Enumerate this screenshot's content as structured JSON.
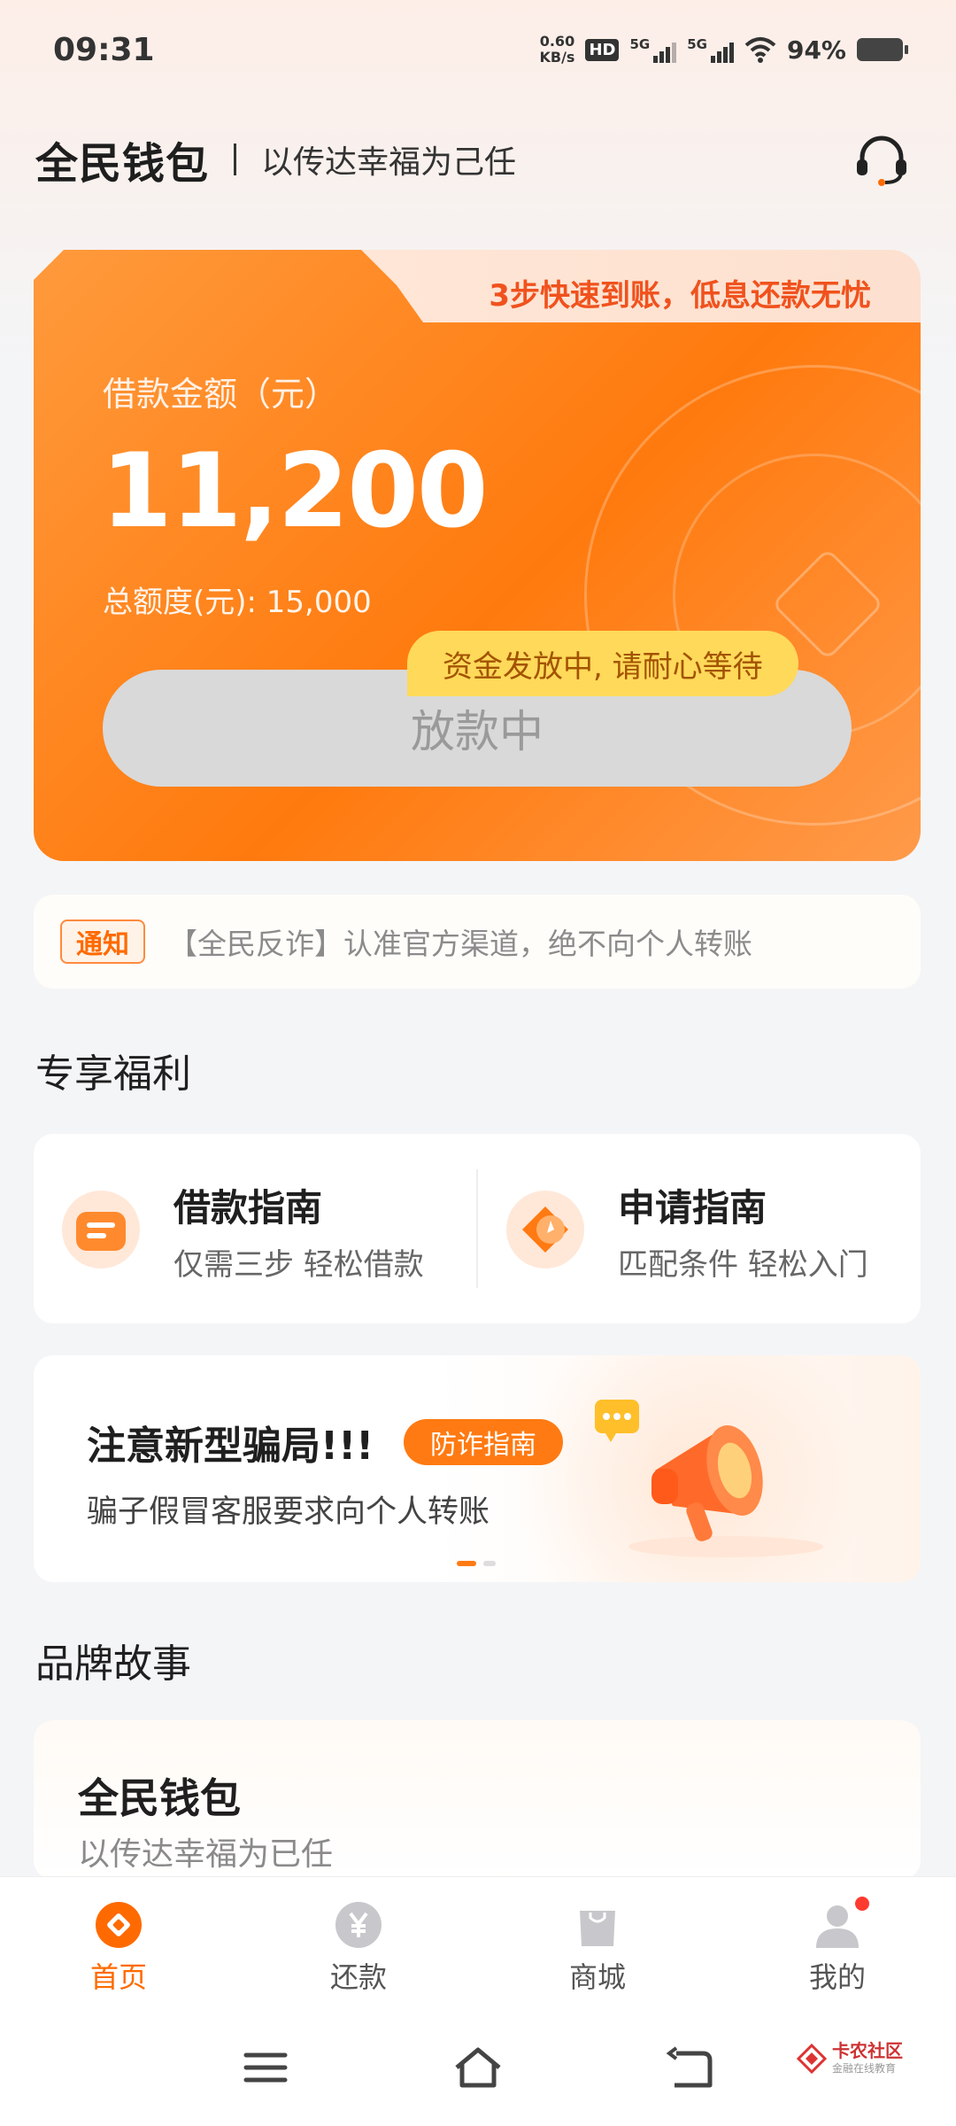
{
  "status_bar": {
    "time": "09:31",
    "net_speed_value": "0.60",
    "net_speed_unit": "KB/s",
    "hd_label": "HD",
    "sim1_label": "5G",
    "sim2_label": "5G",
    "battery": "94%"
  },
  "header": {
    "brand": "全民钱包",
    "slogan": "以传达幸福为己任"
  },
  "loan_card": {
    "tab_text": "3步快速到账，低息还款无忧",
    "amount_label": "借款金额（元）",
    "amount": "11,200",
    "total_limit": "总额度(元): 15,000",
    "status_button": "放款中",
    "tooltip": "资金发放中, 请耐心等待"
  },
  "notice": {
    "tag": "通知",
    "text": "【全民反诈】认准官方渠道，绝不向个人转账"
  },
  "benefits": {
    "title": "专享福利",
    "items": [
      {
        "title": "借款指南",
        "subtitle": "仅需三步 轻松借款"
      },
      {
        "title": "申请指南",
        "subtitle": "匹配条件 轻松入门"
      }
    ]
  },
  "banner": {
    "title": "注意新型骗局!!!",
    "tag": "防诈指南",
    "subtitle": "骗子假冒客服要求向个人转账",
    "active_slide": 1,
    "slide_count": 2
  },
  "brand_story": {
    "section_title": "品牌故事",
    "title": "全民钱包",
    "subtitle": "以传达幸福为已任"
  },
  "tab_bar": {
    "tabs": [
      {
        "label": "首页",
        "icon": "home-icon",
        "active": true
      },
      {
        "label": "还款",
        "icon": "yuan-icon",
        "active": false
      },
      {
        "label": "商城",
        "icon": "shopping-bag-icon",
        "active": false
      },
      {
        "label": "我的",
        "icon": "profile-icon",
        "active": false
      }
    ]
  },
  "watermark": {
    "title": "卡农社区",
    "subtitle": "金融在线教育"
  },
  "colors": {
    "accent": "#ff7a12",
    "card_gradient_start": "#ff9a3c",
    "card_gradient_end": "#ff7a0e",
    "tooltip_bg": "#ffd95a",
    "disabled_button": "#d9d9d9"
  }
}
